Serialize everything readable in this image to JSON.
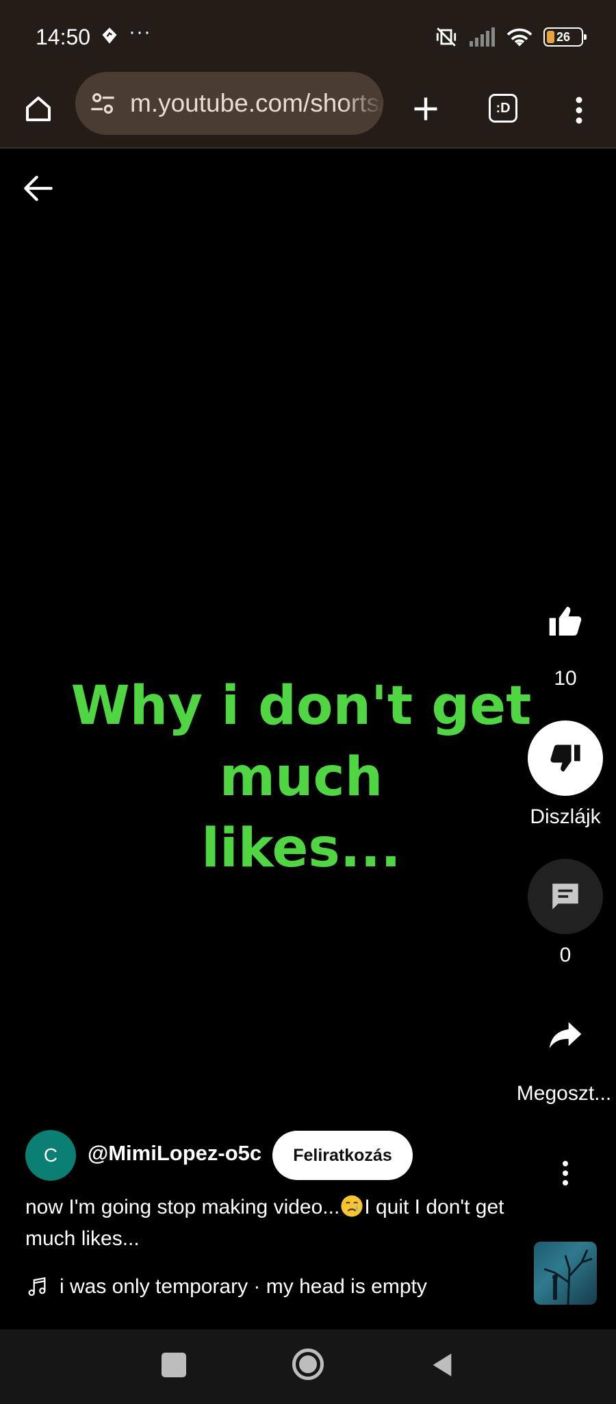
{
  "status_bar": {
    "time": "14:50",
    "dots": "···",
    "battery": "26"
  },
  "browser": {
    "url": "m.youtube.com/shorts/",
    "tab_count": ":D"
  },
  "video": {
    "caption_line1": "Why i don't get much",
    "caption_line2": "likes..."
  },
  "actions": {
    "likes": "10",
    "dislike_label": "Diszlájk",
    "comments": "0",
    "share_label": "Megoszt..."
  },
  "channel": {
    "avatar_letter": "C",
    "name": "@MimiLopez-o5c",
    "subscribe_label": "Feliratkozás"
  },
  "description": {
    "part1": "now I'm going stop making video...",
    "part2": "I quit I don't get much likes..."
  },
  "music": {
    "title": "i was only temporary · my head is empty"
  },
  "icons": {
    "home": "home-icon",
    "site_settings": "tune-icon",
    "new_tab": "plus-icon",
    "menu": "more-vert-icon",
    "back": "arrow-back-icon",
    "like": "thumb-up-icon",
    "dislike": "thumb-down-icon",
    "comment": "comment-icon",
    "share": "share-icon",
    "music": "music-note-icon"
  },
  "colors": {
    "caption": "#4fd642",
    "browser_bg": "#241c17",
    "avatar": "#0b7f74"
  }
}
